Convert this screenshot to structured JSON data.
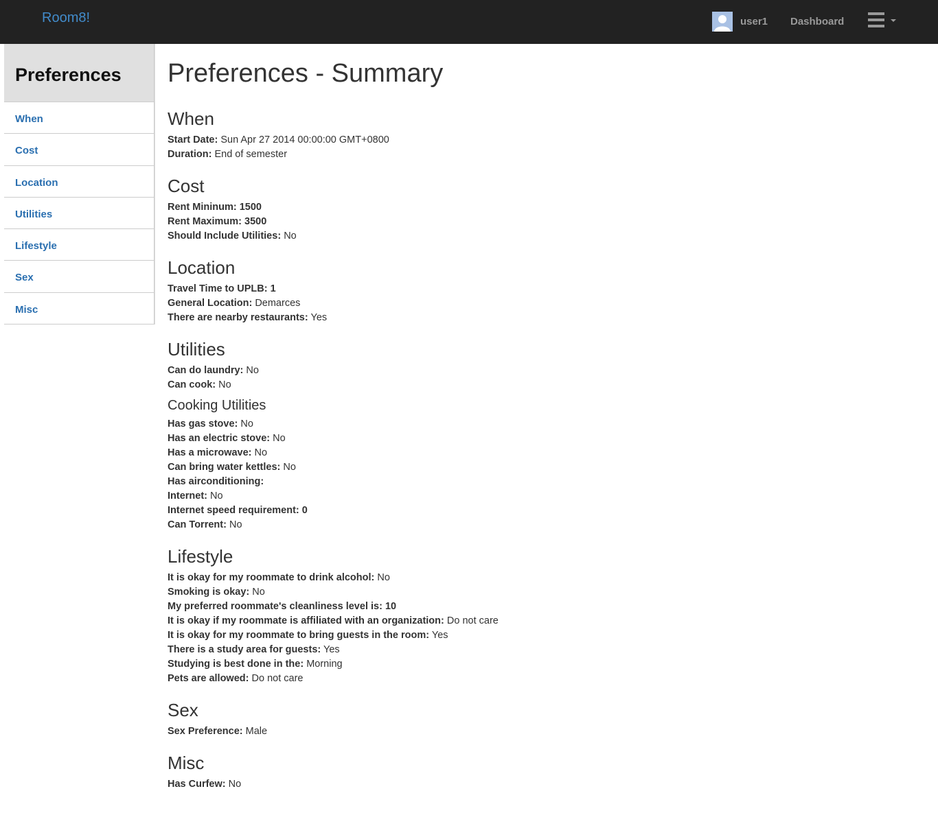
{
  "navbar": {
    "brand": "Room8!",
    "user": "user1",
    "dashboard": "Dashboard"
  },
  "sidebar": {
    "title": "Preferences",
    "items": [
      {
        "label": "When"
      },
      {
        "label": "Cost"
      },
      {
        "label": "Location"
      },
      {
        "label": "Utilities"
      },
      {
        "label": "Lifestyle"
      },
      {
        "label": "Sex"
      },
      {
        "label": "Misc"
      }
    ]
  },
  "main": {
    "title": "Preferences - Summary",
    "when": {
      "heading": "When",
      "start_date_label": "Start Date:",
      "start_date": "Sun Apr 27 2014 00:00:00 GMT+0800",
      "duration_label": "Duration:",
      "duration": "End of semester"
    },
    "cost": {
      "heading": "Cost",
      "rent_min_label": "Rent Mininum:",
      "rent_min": "1500",
      "rent_max_label": "Rent Maximum:",
      "rent_max": "3500",
      "include_util_label": "Should Include Utilities:",
      "include_util": "No"
    },
    "location": {
      "heading": "Location",
      "travel_label": "Travel Time to UPLB:",
      "travel": "1",
      "general_label": "General Location:",
      "general": "Demarces",
      "restaurants_label": "There are nearby restaurants:",
      "restaurants": "Yes"
    },
    "utilities": {
      "heading": "Utilities",
      "laundry_label": "Can do laundry:",
      "laundry": "No",
      "cook_label": "Can cook:",
      "cook": "No",
      "cooking_heading": "Cooking Utilities",
      "gas_label": "Has gas stove:",
      "gas": "No",
      "electric_label": "Has an electric stove:",
      "electric": "No",
      "microwave_label": "Has a microwave:",
      "microwave": "No",
      "kettle_label": "Can bring water kettles:",
      "kettle": "No",
      "aircon_label": "Has airconditioning:",
      "aircon": "",
      "internet_label": "Internet:",
      "internet": "No",
      "speed_label": "Internet speed requirement:",
      "speed": "0",
      "torrent_label": "Can Torrent:",
      "torrent": "No"
    },
    "lifestyle": {
      "heading": "Lifestyle",
      "alcohol_label": "It is okay for my roommate to drink alcohol:",
      "alcohol": "No",
      "smoking_label": "Smoking is okay:",
      "smoking": "No",
      "clean_label": "My preferred roommate's cleanliness level is:",
      "clean": "10",
      "org_label": "It is okay if my roommate is affiliated with an organization:",
      "org": "Do not care",
      "guests_label": "It is okay for my roommate to bring guests in the room:",
      "guests": "Yes",
      "study_area_label": "There is a study area for guests:",
      "study_area": "Yes",
      "study_time_label": "Studying is best done in the:",
      "study_time": "Morning",
      "pets_label": "Pets are allowed:",
      "pets": "Do not care"
    },
    "sex": {
      "heading": "Sex",
      "pref_label": "Sex Preference:",
      "pref": "Male"
    },
    "misc": {
      "heading": "Misc",
      "curfew_label": "Has Curfew:",
      "curfew": "No"
    }
  }
}
